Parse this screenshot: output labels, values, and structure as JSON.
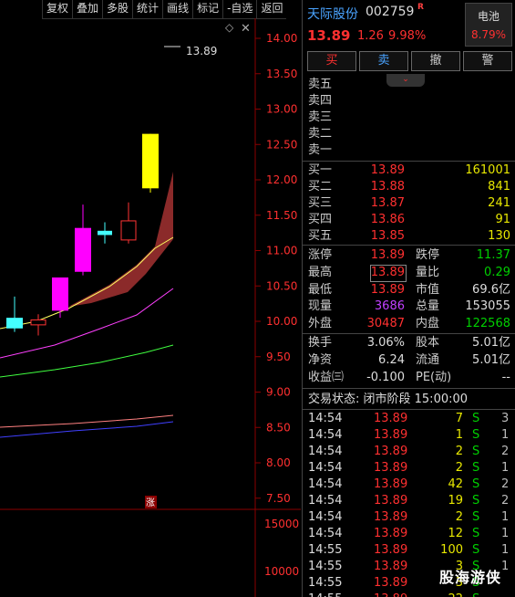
{
  "toolbar": [
    "复权",
    "叠加",
    "多股",
    "统计",
    "画线",
    "标记",
    "-自选",
    "返回"
  ],
  "price_axis": [
    {
      "label": "14.00",
      "v": 14.0
    },
    {
      "label": "13.50",
      "v": 13.5
    },
    {
      "label": "13.00",
      "v": 13.0
    },
    {
      "label": "12.50",
      "v": 12.5
    },
    {
      "label": "12.00",
      "v": 12.0
    },
    {
      "label": "11.50",
      "v": 11.5
    },
    {
      "label": "11.00",
      "v": 11.0
    },
    {
      "label": "10.50",
      "v": 10.5
    },
    {
      "label": "10.00",
      "v": 10.0
    },
    {
      "label": "9.50",
      "v": 9.5
    },
    {
      "label": "9.00",
      "v": 9.0
    },
    {
      "label": "8.50",
      "v": 8.5
    },
    {
      "label": "8.00",
      "v": 8.0
    },
    {
      "label": "7.50",
      "v": 7.5
    }
  ],
  "volume_axis": [
    "15000",
    "10000"
  ],
  "max_marker": "13.89",
  "limit_badge": "涨",
  "candles": [
    {
      "o": 9.9,
      "c": 10.05,
      "h": 10.35,
      "l": 9.85,
      "color": "#4ff"
    },
    {
      "o": 9.95,
      "c": 10.02,
      "h": 10.1,
      "l": 9.8,
      "color": "#f33"
    },
    {
      "o": 10.15,
      "c": 10.62,
      "h": 10.62,
      "l": 10.05,
      "color": "#f0f"
    },
    {
      "o": 10.7,
      "c": 11.32,
      "h": 11.65,
      "l": 10.65,
      "color": "#f0f"
    },
    {
      "o": 11.28,
      "c": 11.22,
      "h": 11.4,
      "l": 11.1,
      "color": "#4ff"
    },
    {
      "o": 11.15,
      "c": 11.42,
      "h": 11.68,
      "l": 11.1,
      "color": "#f33"
    },
    {
      "o": 11.88,
      "c": 12.65,
      "h": 12.65,
      "l": 11.82,
      "color": "#ff0"
    }
  ],
  "header": {
    "name": "天际股份",
    "code": "002759",
    "flag": "R",
    "price": "13.89",
    "change": "1.26",
    "change_pct": "9.98%",
    "sector_name": "电池",
    "sector_pct": "8.79%"
  },
  "buttons": [
    "买",
    "卖",
    "撤",
    "警"
  ],
  "order_book": [
    {
      "label": "卖五",
      "price": "",
      "vol": ""
    },
    {
      "label": "卖四",
      "price": "",
      "vol": ""
    },
    {
      "label": "卖三",
      "price": "",
      "vol": ""
    },
    {
      "label": "卖二",
      "price": "",
      "vol": ""
    },
    {
      "label": "卖一",
      "price": "",
      "vol": ""
    },
    {
      "label": "买一",
      "price": "13.89",
      "vol": "161001"
    },
    {
      "label": "买二",
      "price": "13.88",
      "vol": "841"
    },
    {
      "label": "买三",
      "price": "13.87",
      "vol": "241"
    },
    {
      "label": "买四",
      "price": "13.86",
      "vol": "91"
    },
    {
      "label": "买五",
      "price": "13.85",
      "vol": "130"
    }
  ],
  "stats": {
    "limit_up_label": "涨停",
    "limit_up": "13.89",
    "limit_down_label": "跌停",
    "limit_down": "11.37",
    "high_label": "最高",
    "high": "13.89",
    "vol_ratio_label": "量比",
    "vol_ratio": "0.29",
    "low_label": "最低",
    "low": "13.89",
    "mktcap_label": "市值",
    "mktcap": "69.6亿",
    "cur_vol_label": "现量",
    "cur_vol": "3686",
    "total_vol_label": "总量",
    "total_vol": "153055",
    "outer_label": "外盘",
    "outer": "30487",
    "inner_label": "内盘",
    "inner": "122568",
    "turnover_label": "换手",
    "turnover": "3.06%",
    "equity_label": "股本",
    "equity": "5.01亿",
    "net_asset_label": "净资",
    "net_asset": "6.24",
    "float_label": "流通",
    "float": "5.01亿",
    "eps_label": "收益㈢",
    "eps": "-0.100",
    "pe_label": "PE(动)",
    "pe": "--"
  },
  "trade_status": "交易状态: 闭市阶段 15:00:00",
  "trades": [
    {
      "t": "14:54",
      "p": "13.89",
      "v": "7",
      "s": "S",
      "n": "3"
    },
    {
      "t": "14:54",
      "p": "13.89",
      "v": "1",
      "s": "S",
      "n": "1"
    },
    {
      "t": "14:54",
      "p": "13.89",
      "v": "2",
      "s": "S",
      "n": "2"
    },
    {
      "t": "14:54",
      "p": "13.89",
      "v": "2",
      "s": "S",
      "n": "1"
    },
    {
      "t": "14:54",
      "p": "13.89",
      "v": "42",
      "s": "S",
      "n": "2"
    },
    {
      "t": "14:54",
      "p": "13.89",
      "v": "19",
      "s": "S",
      "n": "2"
    },
    {
      "t": "14:54",
      "p": "13.89",
      "v": "2",
      "s": "S",
      "n": "1"
    },
    {
      "t": "14:54",
      "p": "13.89",
      "v": "12",
      "s": "S",
      "n": "1"
    },
    {
      "t": "14:55",
      "p": "13.89",
      "v": "100",
      "s": "S",
      "n": "1"
    },
    {
      "t": "14:55",
      "p": "13.89",
      "v": "3",
      "s": "S",
      "n": "1"
    },
    {
      "t": "14:55",
      "p": "13.89",
      "v": "3",
      "s": "S",
      "n": ""
    },
    {
      "t": "14:55",
      "p": "13.89",
      "v": "22",
      "s": "S",
      "n": ""
    }
  ],
  "watermark": "股海游侠"
}
